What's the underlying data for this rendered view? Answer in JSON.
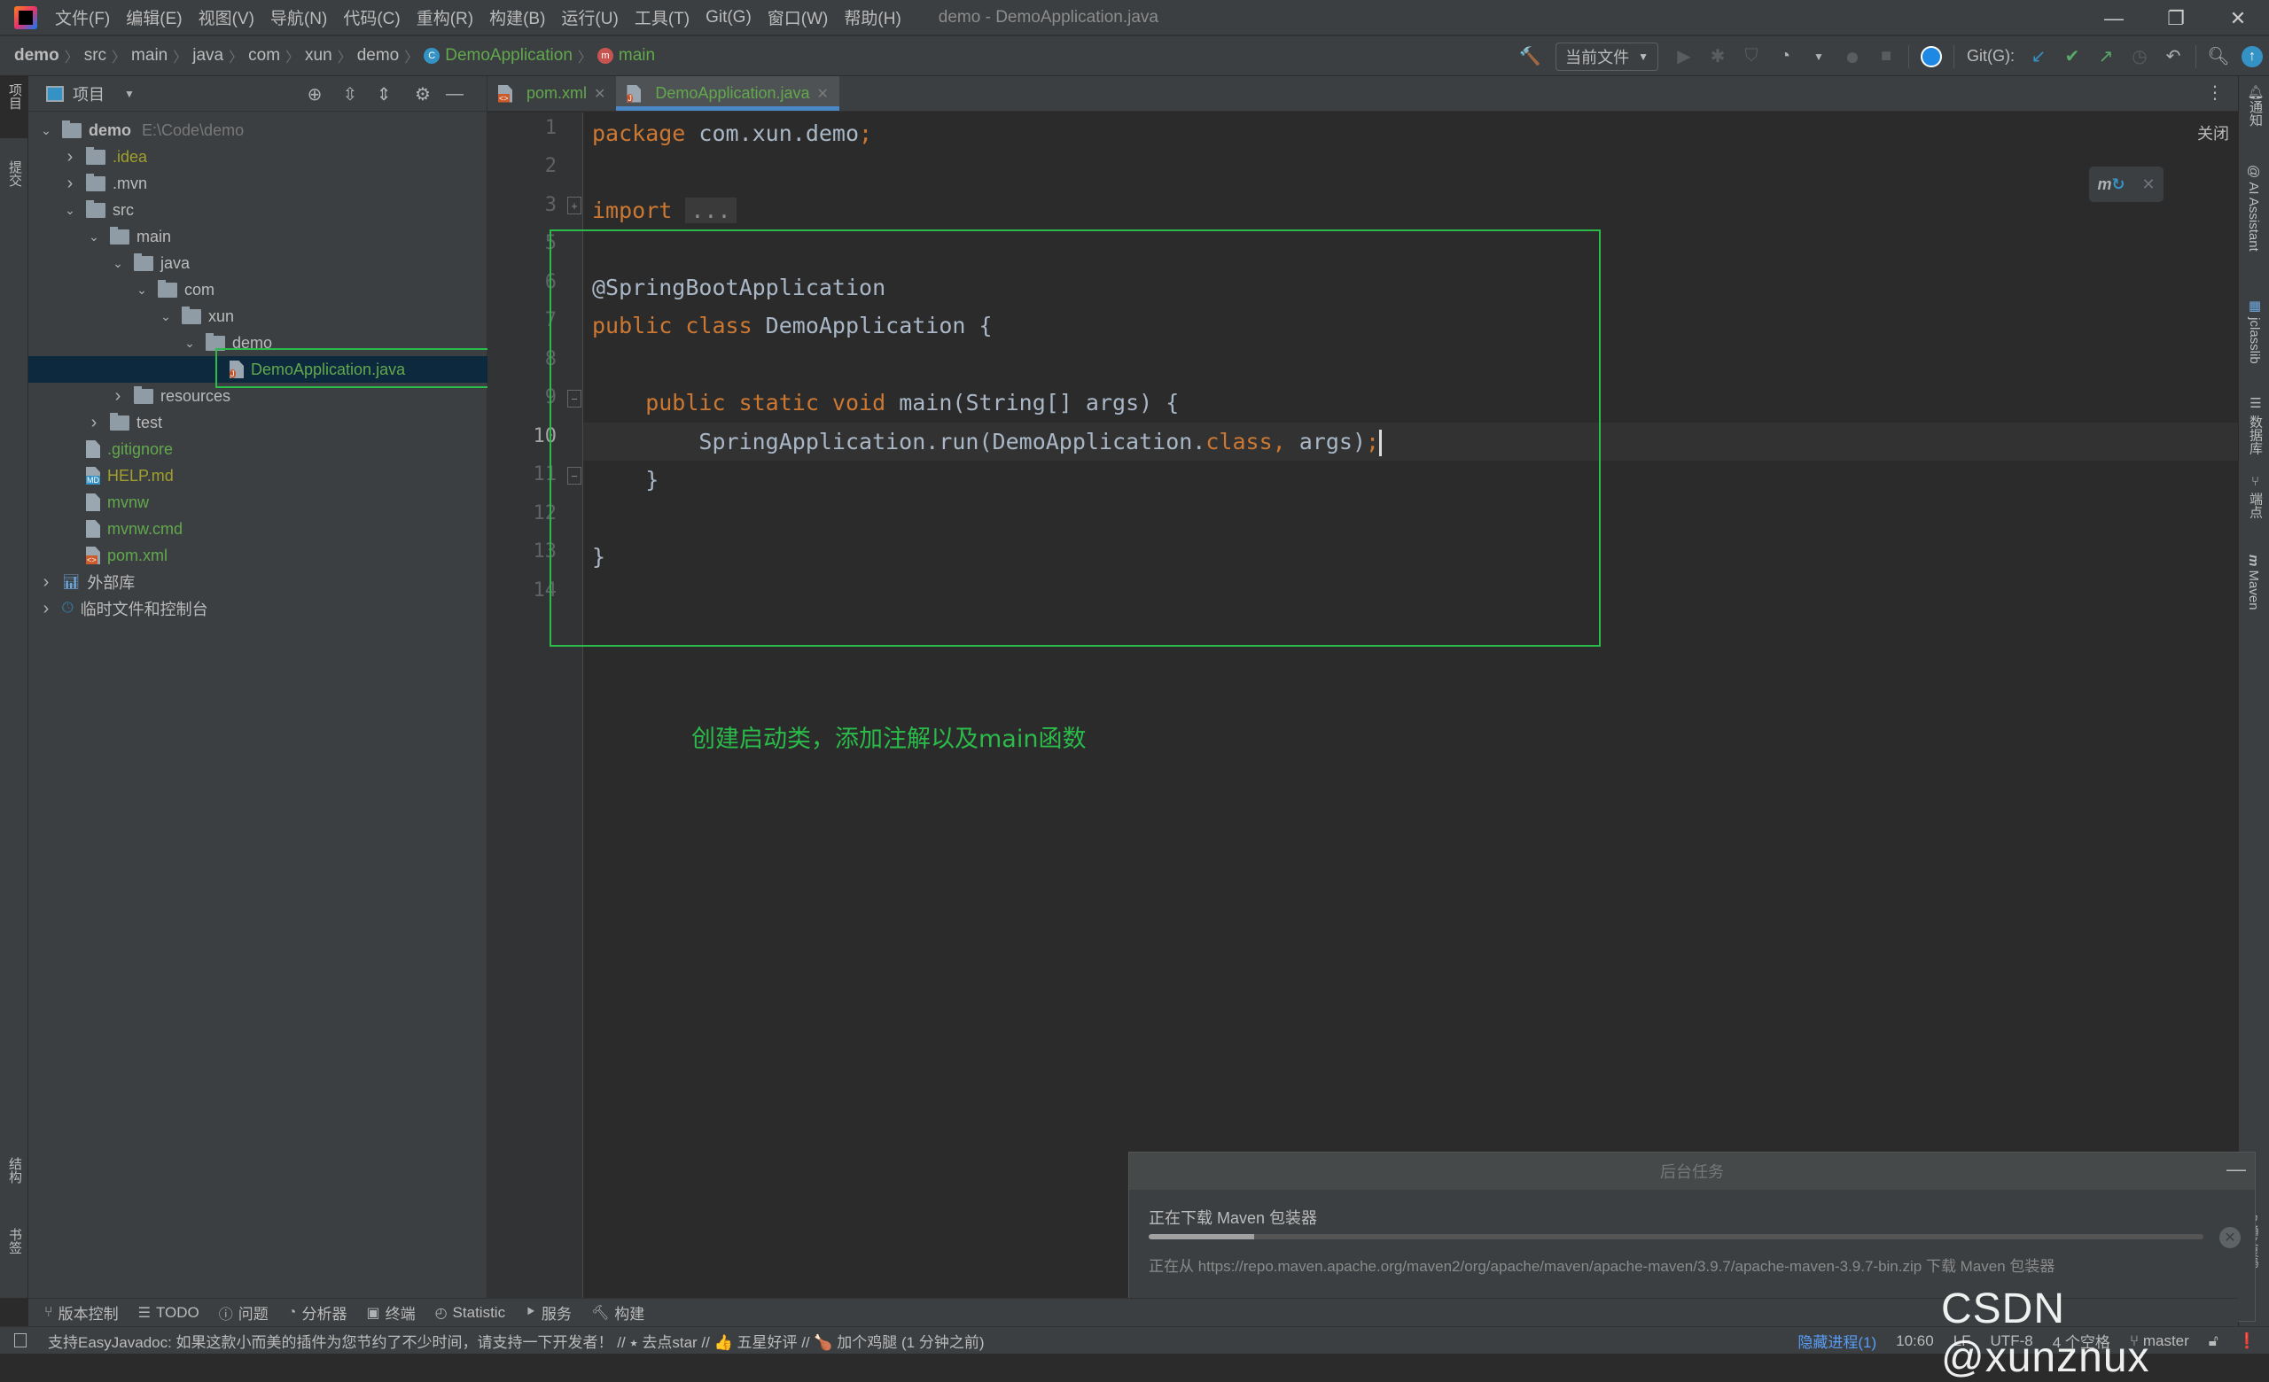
{
  "window": {
    "title": "demo - DemoApplication.java",
    "menu": [
      "文件(F)",
      "编辑(E)",
      "视图(V)",
      "导航(N)",
      "代码(C)",
      "重构(R)",
      "构建(B)",
      "运行(U)",
      "工具(T)",
      "Git(G)",
      "窗口(W)",
      "帮助(H)"
    ],
    "controls": {
      "minimize": "—",
      "restore": "❐",
      "close": "✕"
    }
  },
  "breadcrumb": [
    "demo",
    "src",
    "main",
    "java",
    "com",
    "xun",
    "demo",
    "DemoApplication",
    "main"
  ],
  "toolbar": {
    "run_config": "当前文件",
    "git_label": "Git(G):"
  },
  "left_stripe": [
    "项目",
    "提交",
    "结构",
    "书签"
  ],
  "project": {
    "title": "项目",
    "root_name": "demo",
    "root_path": "E:\\Code\\demo",
    "tree": [
      {
        "name": ".idea",
        "type": "folder",
        "expanded": false,
        "color": "olive"
      },
      {
        "name": ".mvn",
        "type": "folder",
        "expanded": false
      },
      {
        "name": "src",
        "type": "folder",
        "expanded": true
      },
      {
        "name": "main",
        "type": "folder",
        "expanded": true
      },
      {
        "name": "java",
        "type": "folder",
        "expanded": true
      },
      {
        "name": "com",
        "type": "folder",
        "expanded": true
      },
      {
        "name": "xun",
        "type": "folder",
        "expanded": true
      },
      {
        "name": "demo",
        "type": "folder",
        "expanded": true
      },
      {
        "name": "DemoApplication.java",
        "type": "java",
        "selected": true
      },
      {
        "name": "resources",
        "type": "folder",
        "expanded": false
      },
      {
        "name": "test",
        "type": "folder",
        "expanded": false
      },
      {
        "name": ".gitignore",
        "type": "file"
      },
      {
        "name": "HELP.md",
        "type": "md"
      },
      {
        "name": "mvnw",
        "type": "file"
      },
      {
        "name": "mvnw.cmd",
        "type": "file"
      },
      {
        "name": "pom.xml",
        "type": "xml"
      },
      {
        "name": "外部库",
        "type": "library"
      },
      {
        "name": "临时文件和控制台",
        "type": "scratch"
      }
    ]
  },
  "tabs": [
    {
      "label": "pom.xml",
      "active": false
    },
    {
      "label": "DemoApplication.java",
      "active": true
    }
  ],
  "editor": {
    "close_link": "关闭",
    "line_numbers": [
      "1",
      "2",
      "3",
      "5",
      "6",
      "7",
      "8",
      "9",
      "10",
      "11",
      "12",
      "13",
      "14"
    ],
    "current_line": "10",
    "code": {
      "l1_kw": "package",
      "l1_rest": " com.xun.demo",
      "l1_semi": ";",
      "l3_kw": "import",
      "l3_fold": "...",
      "l6": "@SpringBootApplication",
      "l7_kw": "public class",
      "l7_rest": " DemoApplication {",
      "l9_kw": "    public static void",
      "l9_rest": " main(String[] args) {",
      "l10_a": "        SpringApplication.run(DemoApplication.",
      "l10_kw": "class",
      "l10_comma": ",",
      "l10_b": " args)",
      "l10_semi": ";",
      "l11": "    }",
      "l13": "}"
    },
    "annotation": "创建启动类，添加注解以及main函数"
  },
  "right_stripe": [
    "通知",
    "AI Assistant",
    "jclasslib",
    "数据库",
    "端点",
    "Maven",
    "通义灵码"
  ],
  "background_tasks": {
    "header": "后台任务",
    "title": "正在下载 Maven 包装器",
    "progress_percent": 10,
    "detail": "正在从 https://repo.maven.apache.org/maven2/org/apache/maven/apache-maven/3.9.7/apache-maven-3.9.7-bin.zip 下载 Maven 包装器"
  },
  "bottom_tools": [
    "版本控制",
    "TODO",
    "问题",
    "分析器",
    "终端",
    "Statistic",
    "服务",
    "构建"
  ],
  "status": {
    "message": "支持EasyJavadoc: 如果这款小而美的插件为您节约了不少时间，请支持一下开发者！ // ⭑ 去点star // 👍 五星好评 // 🍗 加个鸡腿 (1 分钟之前)",
    "hidden_processes": "隐藏进程(1)",
    "position": "10:60",
    "line_sep": "LF",
    "encoding": "UTF-8",
    "indent": "4 个空格",
    "branch": "master"
  },
  "watermark": "CSDN @xunznux",
  "colors": {
    "accent": "#4a88c7",
    "annotation_green": "#2bbb4a",
    "keyword": "#cc7832",
    "vcs_added": "#62a84d"
  }
}
